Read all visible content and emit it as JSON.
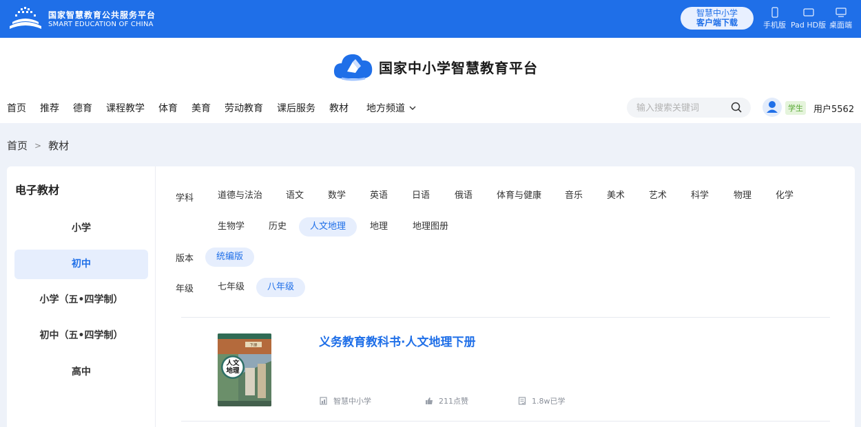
{
  "topbar": {
    "logo_cn": "国家智慧教育公共服务平台",
    "logo_en": "SMART EDUCATION OF CHINA",
    "download_line1": "智慧中小学",
    "download_line2": "客户端下载",
    "devices": [
      {
        "label": "手机版",
        "icon": "phone-icon"
      },
      {
        "label": "Pad HD版",
        "icon": "tablet-icon"
      },
      {
        "label": "桌面端",
        "icon": "desktop-icon"
      }
    ]
  },
  "header": {
    "brand": "国家中小学智慧教育平台",
    "nav": [
      "首页",
      "推荐",
      "德育",
      "课程教学",
      "体育",
      "美育",
      "劳动教育",
      "课后服务",
      "教材"
    ],
    "nav_region": "地方频道",
    "search_placeholder": "输入搜索关键词",
    "user_role": "学生",
    "username": "用户5562"
  },
  "breadcrumb": {
    "home": "首页",
    "sep": ">",
    "current": "教材"
  },
  "sidebar": {
    "title": "电子教材",
    "items": [
      "小学",
      "初中",
      "小学（五•四学制）",
      "初中（五•四学制）",
      "高中"
    ],
    "active_index": 1
  },
  "filters": {
    "subject_label": "学科",
    "subjects_row1": [
      "道德与法治",
      "语文",
      "数学",
      "英语",
      "日语",
      "俄语",
      "体育与健康",
      "音乐",
      "美术",
      "艺术",
      "科学",
      "物理",
      "化学"
    ],
    "subjects_row2": [
      "生物学",
      "历史",
      "人文地理",
      "地理",
      "地理图册"
    ],
    "active_subject": "人文地理",
    "edition_label": "版本",
    "editions": [
      "统编版"
    ],
    "active_edition": "统编版",
    "grade_label": "年级",
    "grades": [
      "七年级",
      "八年级"
    ],
    "active_grade": "八年级"
  },
  "book": {
    "title": "义务教育教科书·人文地理下册",
    "cover_title_1": "人文",
    "cover_title_2": "地理",
    "cover_volume": "下册",
    "publisher": "智慧中小学",
    "likes": "211点赞",
    "learners": "1.8w已学"
  },
  "colors": {
    "brand_blue": "#1f6fe8",
    "active_bg": "#e6eefd",
    "page_bg": "#eef2f9"
  }
}
